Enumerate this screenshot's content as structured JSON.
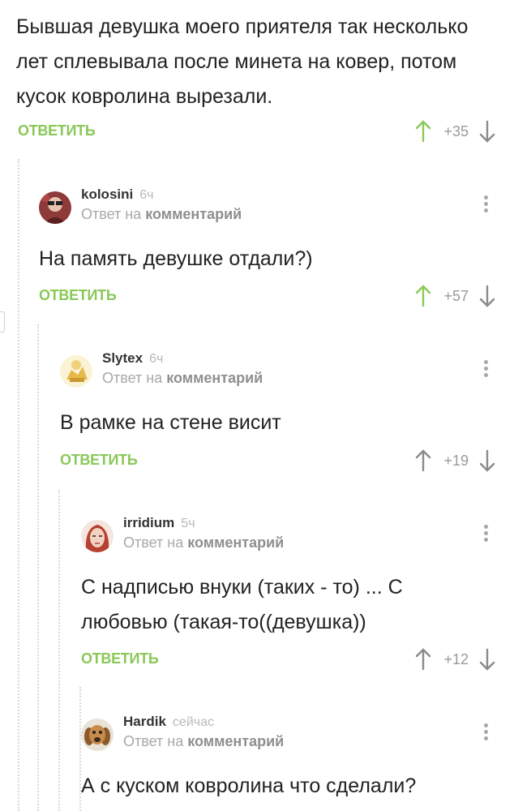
{
  "post_comment": {
    "text": "Бывшая девушка моего приятеля так несколько лет сплевывала после минета на ковер, потом кусок ковролина вырезали.",
    "reply_label": "ОТВЕТИТЬ",
    "rating": "+35"
  },
  "comments": [
    {
      "username": "kolosini",
      "time": "6ч",
      "reply_prefix": "Ответ на",
      "reply_target": "комментарий",
      "text": "На память девушке отдали?)",
      "reply_label": "ОТВЕТИТЬ",
      "rating": "+57",
      "upvote_active": true
    },
    {
      "username": "Slytex",
      "time": "6ч",
      "reply_prefix": "Ответ на",
      "reply_target": "комментарий",
      "text": "В рамке на стене висит",
      "reply_label": "ОТВЕТИТЬ",
      "rating": "+19",
      "upvote_active": false
    },
    {
      "username": "irridium",
      "time": "5ч",
      "reply_prefix": "Ответ на",
      "reply_target": "комментарий",
      "text": "С надписью внуки (таких - то) ... С любовью (такая-то((девушка))",
      "reply_label": "ОТВЕТИТЬ",
      "rating": "+12",
      "upvote_active": false
    },
    {
      "username": "Hardik",
      "time": "сейчас",
      "reply_prefix": "Ответ на",
      "reply_target": "комментарий",
      "text": "А с куском ковролина что сделали?"
    }
  ],
  "icons": {
    "upvote": "arrow-up-icon",
    "downvote": "arrow-down-icon",
    "more": "more-vertical-icon"
  },
  "colors": {
    "accent_green": "#8ac858",
    "muted_gray": "#a8a8a8",
    "text": "#222222"
  }
}
